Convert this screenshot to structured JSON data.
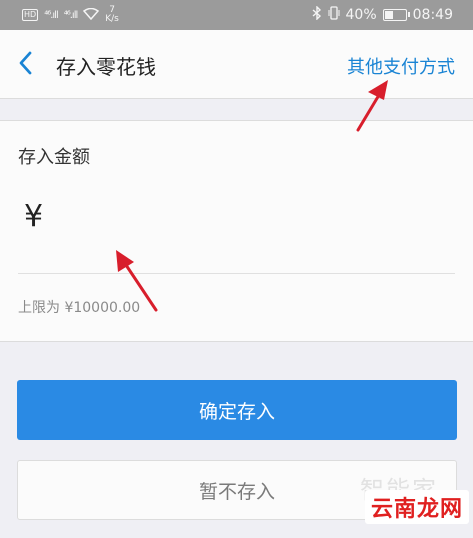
{
  "status_bar": {
    "network_badge": "HD",
    "signal_1": "⁴⁶.ıll",
    "signal_2": "⁴⁶.ıll",
    "speed_value": "7",
    "speed_unit": "K/s",
    "battery_percent": "40%",
    "time": "08:49"
  },
  "header": {
    "title": "存入零花钱",
    "other_payment": "其他支付方式"
  },
  "form": {
    "amount_label": "存入金额",
    "currency_symbol": "¥",
    "amount_value": "",
    "limit_text": "上限为 ¥10000.00"
  },
  "buttons": {
    "confirm": "确定存入",
    "skip": "暂不存入"
  },
  "watermarks": {
    "faint_text": "智能家",
    "logo_text": "云南龙网"
  },
  "colors": {
    "accent": "#2a8ae4",
    "link": "#1a84d4",
    "annotation_arrow": "#d81e2c"
  }
}
